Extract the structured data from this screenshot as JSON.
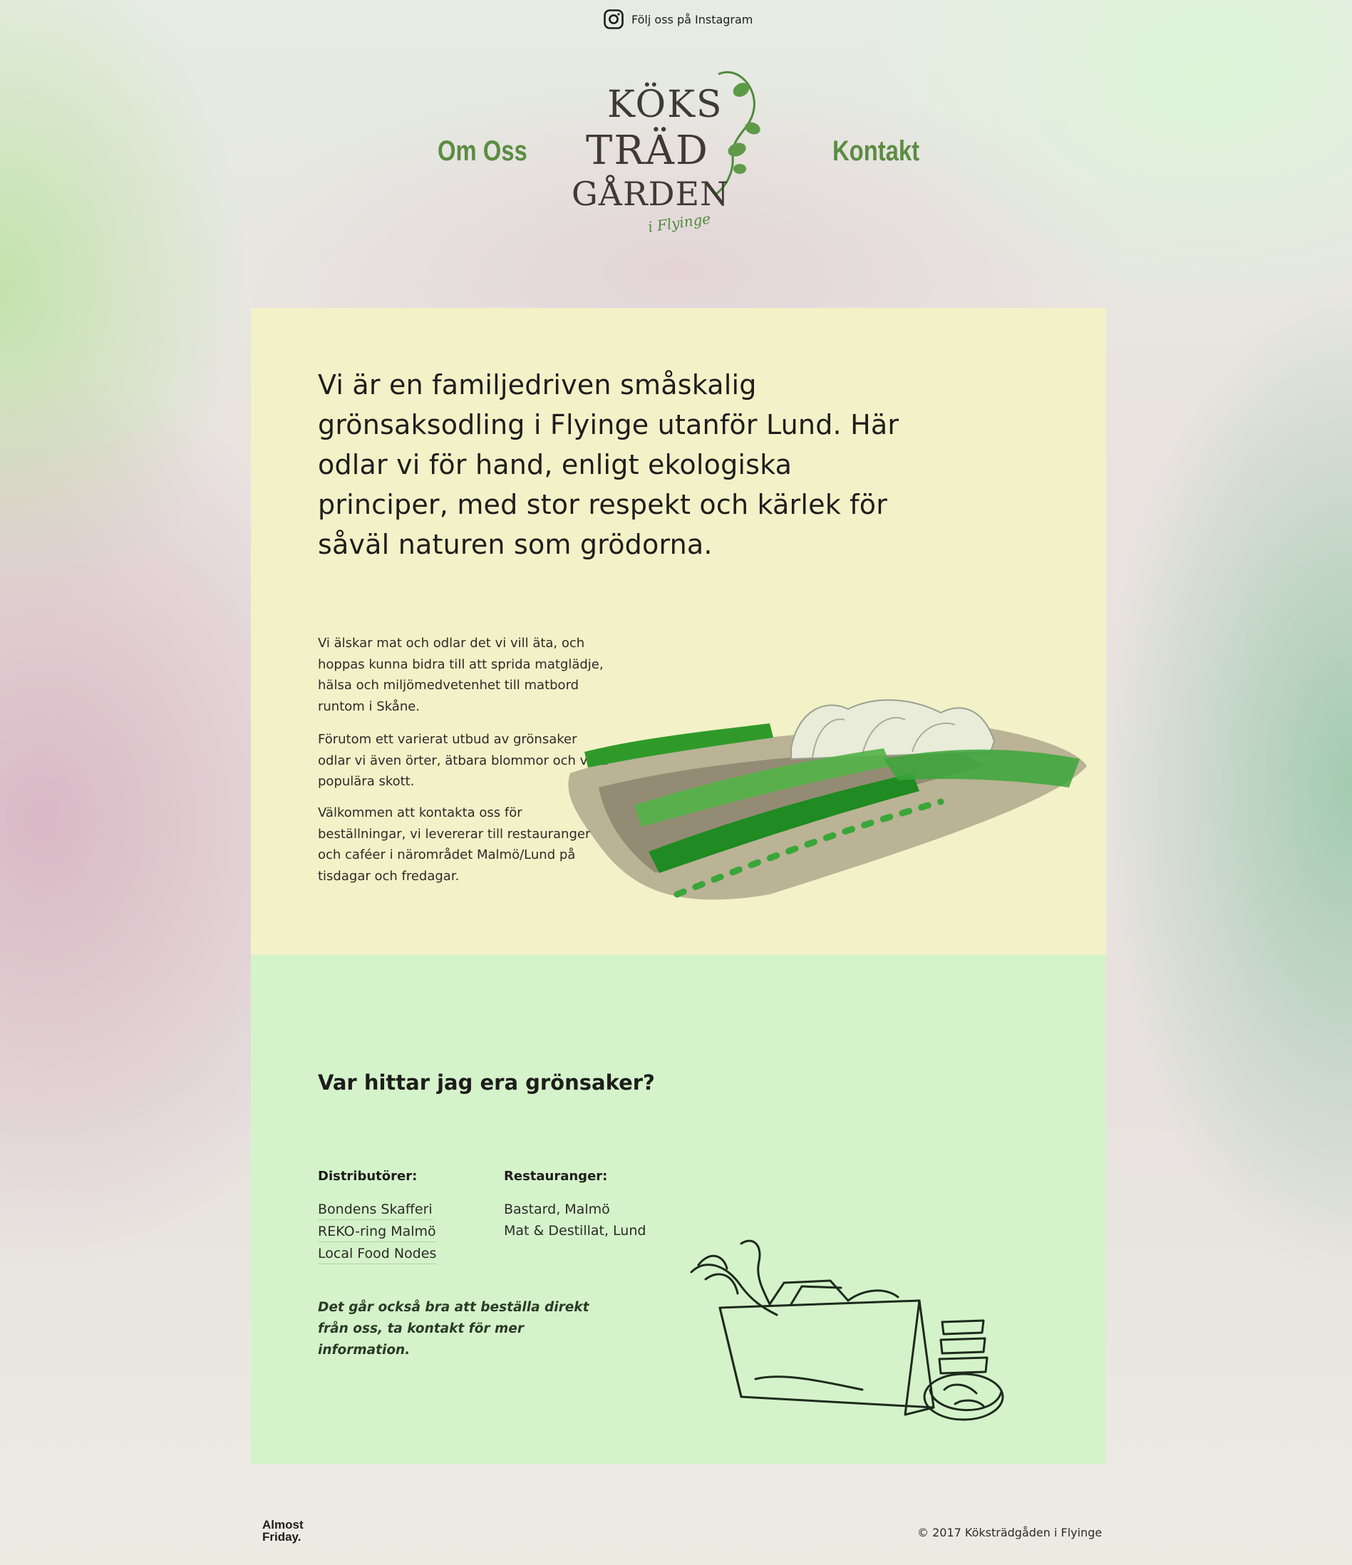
{
  "header": {
    "instagram_label": "Följ oss på Instagram",
    "nav_about": "Om Oss",
    "nav_contact": "Kontakt",
    "logo": {
      "line1": "KÖKS",
      "line2": "TRÄD",
      "line3": "GÅRDEN",
      "script": "i Flyinge"
    }
  },
  "intro": {
    "lead": "Vi är en familjedriven småskalig grönsaksodling i Flyinge utanför Lund. Här odlar vi för hand, enligt ekologiska principer, med stor respekt och kärlek för såväl naturen som grödorna.",
    "paragraphs": [
      "Vi älskar mat och odlar det vi vill äta, och hoppas kunna bidra till att sprida matglädje, hälsa och miljömedvetenhet till matbord runtom i Skåne.",
      "Förutom ett varierat utbud av grönsaker odlar vi även örter, ätbara blommor och våra populära skott.",
      "Välkommen att kontakta oss för beställningar, vi levererar till restauranger och caféer i närområdet Malmö/Lund på tisdagar och fredagar."
    ]
  },
  "where": {
    "heading": "Var hittar jag era grönsaker?",
    "distributors_heading": "Distributörer:",
    "distributors": [
      "Bondens Skafferi",
      "REKO-ring Malmö",
      "Local Food Nodes"
    ],
    "restaurants_heading": "Restauranger:",
    "restaurants": [
      "Bastard, Malmö",
      "Mat & Destillat, Lund"
    ],
    "note": "Det går också bra att beställa direkt från oss, ta kontakt för mer information."
  },
  "footer": {
    "brand_line1": "Almost",
    "brand_line2": "Friday.",
    "copyright": "© 2017 Köksträdgåden i Flyinge"
  },
  "colors": {
    "accent_green": "#5b8c43",
    "intro_bg": "#f3f1c8",
    "where_bg": "#d5f3ca",
    "text": "#1d1d1b"
  },
  "icons": [
    "instagram-icon"
  ]
}
